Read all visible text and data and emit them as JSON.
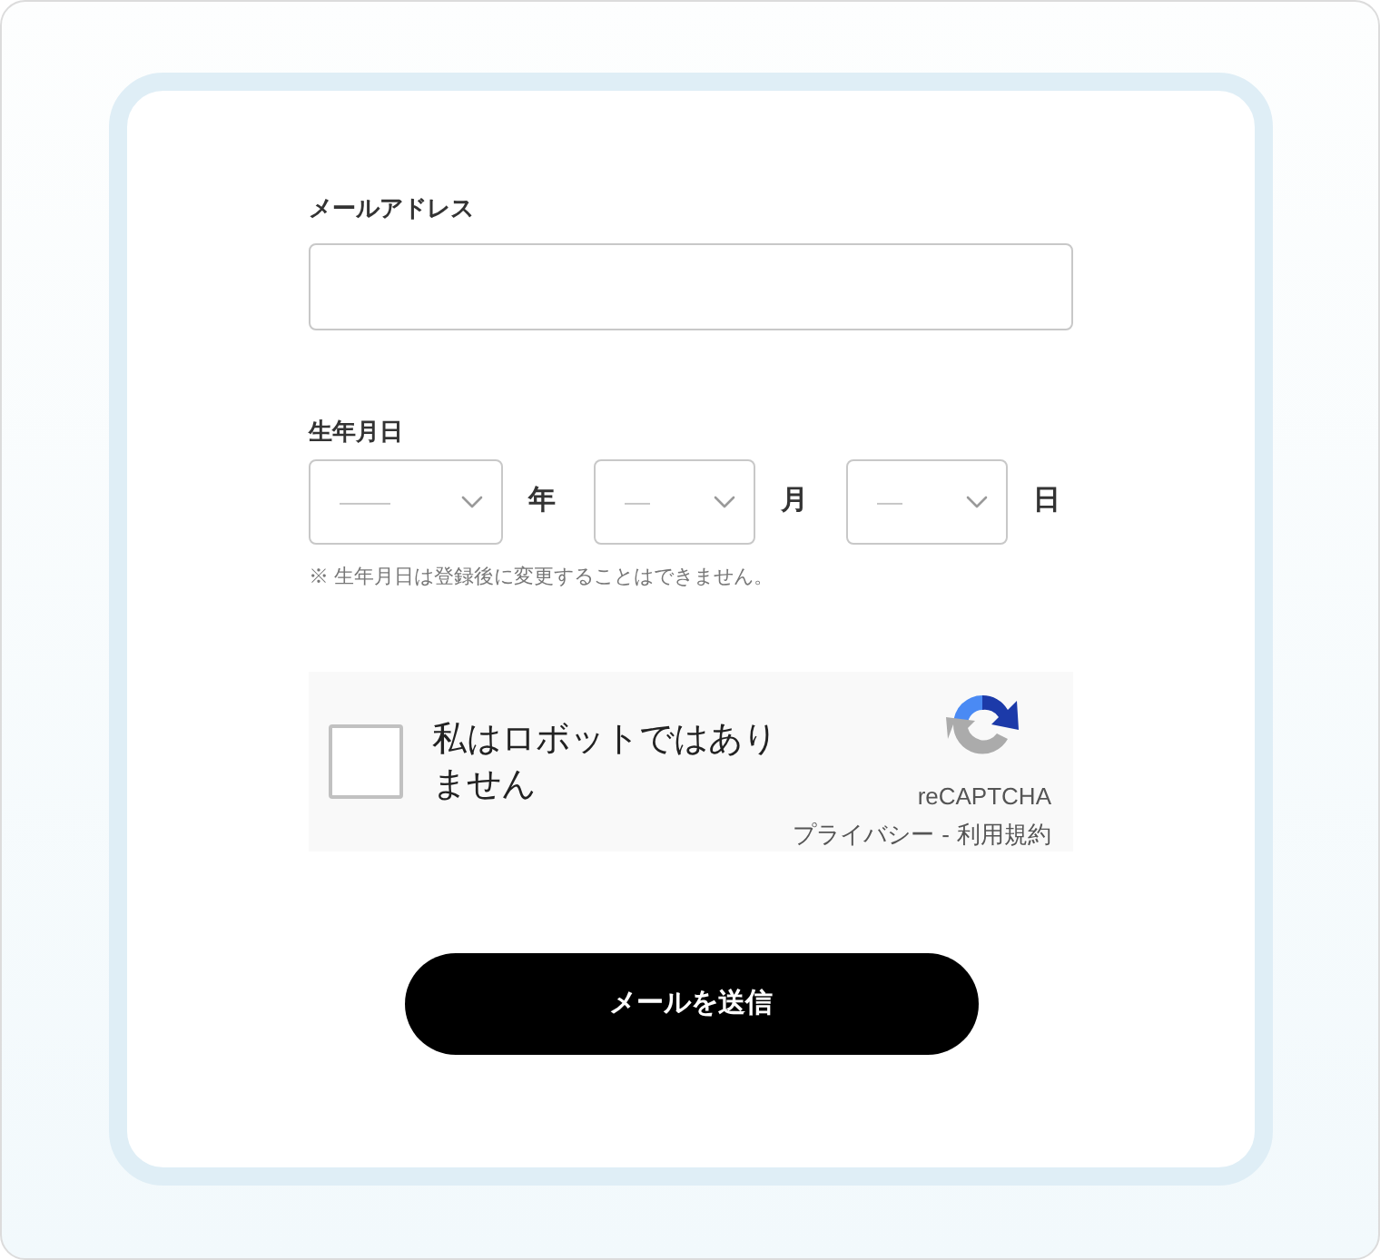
{
  "email": {
    "label": "メールアドレス"
  },
  "birthdate": {
    "label": "生年月日",
    "selects": [
      {
        "placeholder": "——",
        "unit": "年"
      },
      {
        "placeholder": "—",
        "unit": "月"
      },
      {
        "placeholder": "—",
        "unit": "日"
      }
    ],
    "note": "※ 生年月日は登録後に変更することはできません。"
  },
  "recaptcha": {
    "label": "私はロボットではありません",
    "checked": false,
    "brand": "reCAPTCHA",
    "links": [
      "プライバシー",
      "利用規約"
    ],
    "separator": "-"
  },
  "submit_button": {
    "label": "メールを送信"
  }
}
